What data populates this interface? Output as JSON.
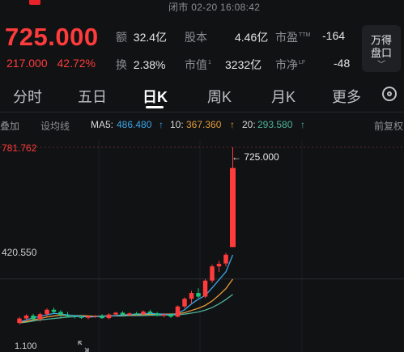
{
  "status_bar": {
    "text": "闭市  02-20 16:08:42"
  },
  "quote": {
    "price": "725.000",
    "change_amount": "217.000",
    "change_percent": "42.72%"
  },
  "stats": {
    "turnover_label": "额",
    "turnover_value": "32.4亿",
    "shares_label": "股本",
    "shares_value": "4.46亿",
    "pe_label": "市盈",
    "pe_sup": "TTM",
    "pe_value": "-164",
    "turnover_rate_label": "换",
    "turnover_rate_value": "2.38%",
    "mktcap_label": "市值",
    "mktcap_sup": "1",
    "mktcap_value": "3232亿",
    "pb_label": "市净",
    "pb_sup": "LF",
    "pb_value": "-48"
  },
  "wande_button": {
    "line1": "万得",
    "line2": "盘口"
  },
  "tabs": [
    {
      "label": "分时"
    },
    {
      "label": "五日"
    },
    {
      "label": "日K",
      "active": true
    },
    {
      "label": "周K"
    },
    {
      "label": "月K"
    },
    {
      "label": "更多"
    }
  ],
  "ma_row": {
    "overlay": "叠加",
    "drawline": "设均线",
    "ma5_label": "MA5:",
    "ma5_value": "486.480",
    "ma10_label": "10:",
    "ma10_value": "367.360",
    "ma20_label": "20:",
    "ma20_value": "293.580",
    "arrow": "↑",
    "adjust": "前复权"
  },
  "axis": {
    "top_label": "781.762",
    "mid_label": "420.550"
  },
  "annotation": {
    "text": "← 725.000"
  },
  "bottom": {
    "partial_text": "1.100"
  },
  "colors": {
    "up": "#ff3b3b",
    "down": "#1ec27a",
    "ma5": "#3aa6e8",
    "ma10": "#e39b3b",
    "ma20": "#4fb39a"
  },
  "chart_data": {
    "type": "candlestick",
    "ylim": [
      300,
      781.762
    ],
    "reference_lines": [
      781.762,
      420.55
    ],
    "candles": [
      {
        "o": 300,
        "h": 316,
        "l": 296,
        "c": 312
      },
      {
        "o": 312,
        "h": 324,
        "l": 306,
        "c": 320
      },
      {
        "o": 320,
        "h": 325,
        "l": 308,
        "c": 310
      },
      {
        "o": 310,
        "h": 328,
        "l": 304,
        "c": 324
      },
      {
        "o": 324,
        "h": 340,
        "l": 318,
        "c": 336
      },
      {
        "o": 336,
        "h": 342,
        "l": 326,
        "c": 330
      },
      {
        "o": 330,
        "h": 335,
        "l": 316,
        "c": 322
      },
      {
        "o": 322,
        "h": 330,
        "l": 315,
        "c": 318
      },
      {
        "o": 318,
        "h": 322,
        "l": 312,
        "c": 316
      },
      {
        "o": 316,
        "h": 321,
        "l": 311,
        "c": 314
      },
      {
        "o": 314,
        "h": 320,
        "l": 310,
        "c": 318
      },
      {
        "o": 318,
        "h": 321,
        "l": 314,
        "c": 319
      },
      {
        "o": 319,
        "h": 324,
        "l": 311,
        "c": 313
      },
      {
        "o": 313,
        "h": 326,
        "l": 310,
        "c": 323
      },
      {
        "o": 323,
        "h": 330,
        "l": 319,
        "c": 328
      },
      {
        "o": 328,
        "h": 332,
        "l": 320,
        "c": 322
      },
      {
        "o": 322,
        "h": 329,
        "l": 318,
        "c": 326
      },
      {
        "o": 326,
        "h": 330,
        "l": 320,
        "c": 324
      },
      {
        "o": 324,
        "h": 334,
        "l": 321,
        "c": 331
      },
      {
        "o": 331,
        "h": 336,
        "l": 324,
        "c": 326
      },
      {
        "o": 326,
        "h": 330,
        "l": 318,
        "c": 320
      },
      {
        "o": 320,
        "h": 327,
        "l": 315,
        "c": 323
      },
      {
        "o": 323,
        "h": 326,
        "l": 314,
        "c": 317
      },
      {
        "o": 317,
        "h": 348,
        "l": 315,
        "c": 345
      },
      {
        "o": 345,
        "h": 370,
        "l": 340,
        "c": 366
      },
      {
        "o": 366,
        "h": 388,
        "l": 352,
        "c": 382
      },
      {
        "o": 382,
        "h": 395,
        "l": 368,
        "c": 372
      },
      {
        "o": 372,
        "h": 420,
        "l": 368,
        "c": 416
      },
      {
        "o": 416,
        "h": 460,
        "l": 410,
        "c": 455
      },
      {
        "o": 455,
        "h": 470,
        "l": 440,
        "c": 462
      },
      {
        "o": 463,
        "h": 492,
        "l": 455,
        "c": 487
      },
      {
        "o": 508,
        "h": 781.762,
        "l": 508,
        "c": 725
      }
    ],
    "ma5": [
      302,
      308,
      314,
      318,
      322,
      326,
      324,
      322,
      320,
      318,
      316,
      317,
      318,
      318,
      320,
      322,
      323,
      324,
      325,
      326,
      325,
      324,
      322,
      326,
      336,
      352,
      365,
      375,
      396,
      418,
      440,
      486.48
    ],
    "ma10": [
      300,
      304,
      308,
      312,
      316,
      319,
      321,
      321,
      320,
      320,
      319,
      318,
      318,
      319,
      320,
      321,
      322,
      322,
      323,
      323,
      324,
      324,
      324,
      325,
      328,
      334,
      340,
      348,
      360,
      376,
      394,
      420
    ],
    "ma20": [
      300,
      302,
      305,
      308,
      310,
      312,
      314,
      316,
      317,
      318,
      318,
      318,
      319,
      319,
      319,
      319,
      320,
      320,
      320,
      321,
      321,
      321,
      322,
      322,
      324,
      327,
      330,
      335,
      342,
      352,
      364,
      378
    ]
  }
}
